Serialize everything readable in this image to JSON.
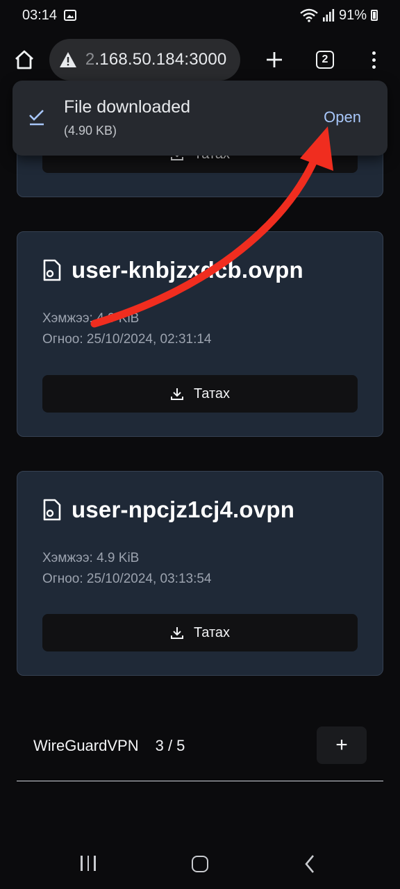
{
  "status_bar": {
    "time": "03:14",
    "battery": "91%",
    "icons": [
      "gallery-icon",
      "wifi-icon",
      "signal-icon",
      "battery-icon"
    ]
  },
  "browser": {
    "url_dim_prefix": "2",
    "url_rest": ".168.50.184:3000",
    "tab_count": "2",
    "icons": [
      "home-icon",
      "warning-icon",
      "plus-icon",
      "tabs-icon",
      "menu-icon"
    ]
  },
  "snackbar": {
    "title": "File downloaded",
    "subtitle": "(4.90 KB)",
    "action": "Open",
    "icon": "download-check-icon"
  },
  "cards": [
    {
      "button_label": "Татах"
    },
    {
      "title": "user-knbjzxdcb.ovpn",
      "size": "Хэмжээ: 4.9 KiB",
      "date": "Огноо: 25/10/2024, 02:31:14",
      "button_label": "Татах"
    },
    {
      "title": "user-npcjz1cj4.ovpn",
      "size": "Хэмжээ: 4.9 KiB",
      "date": "Огноо: 25/10/2024, 03:13:54",
      "button_label": "Татах"
    }
  ],
  "footer": {
    "brand": "WireGuardVPN",
    "count": "3 / 5",
    "add_label": "+"
  },
  "colors": {
    "background": "#0b0b0d",
    "card": "#1f2937",
    "button": "#111113",
    "link": "#a8c7fa",
    "annotation_arrow": "#f02d1f"
  }
}
